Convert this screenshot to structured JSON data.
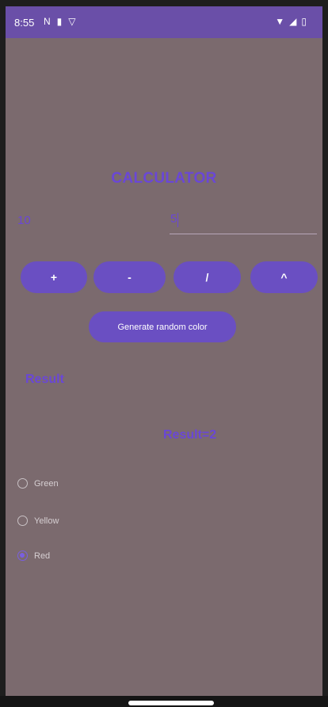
{
  "status_bar": {
    "time": "8:55",
    "icons_left": [
      "n",
      "lock",
      "filter"
    ],
    "icons_right": [
      "wifi",
      "signal",
      "battery"
    ]
  },
  "calculator": {
    "title": "CALCULATOR",
    "input1_value": "10",
    "input2_value": "5",
    "buttons": {
      "plus": "+",
      "minus": "-",
      "divide": "/",
      "power": "^"
    },
    "generate_button": "Generate random color",
    "result_label": "Result",
    "result_value": "Result=2"
  },
  "radio_options": [
    {
      "label": "Green",
      "checked": false
    },
    {
      "label": "Yellow",
      "checked": false
    },
    {
      "label": "Red",
      "checked": true
    }
  ],
  "colors": {
    "background": "#7b6a6e",
    "status_bar": "#6a4fa8",
    "accent": "#6a47d6",
    "button": "#6a4fc2"
  }
}
